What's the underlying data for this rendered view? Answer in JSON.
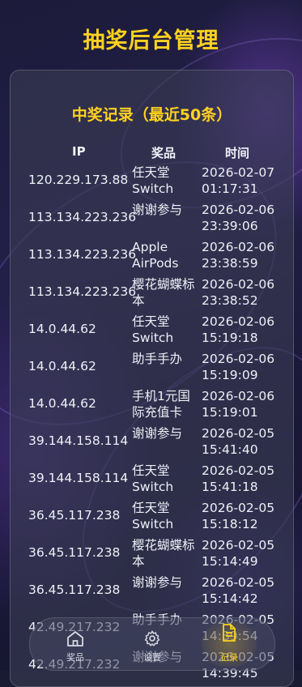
{
  "page": {
    "title": "抽奖后台管理"
  },
  "records": {
    "title": "中奖记录（最近50条）",
    "headers": {
      "ip": "IP",
      "prize": "奖品",
      "time": "时间"
    },
    "rows": [
      {
        "ip": "120.229.173.88",
        "prize": "任天堂 Switch",
        "time": "2026-02-07 01:17:31"
      },
      {
        "ip": "113.134.223.236",
        "prize": "谢谢参与",
        "time": "2026-02-06 23:39:06"
      },
      {
        "ip": "113.134.223.236",
        "prize": "Apple AirPods",
        "time": "2026-02-06 23:38:59"
      },
      {
        "ip": "113.134.223.236",
        "prize": "樱花蝴蝶标本",
        "time": "2026-02-06 23:38:52"
      },
      {
        "ip": "14.0.44.62",
        "prize": "任天堂 Switch",
        "time": "2026-02-06 15:19:18"
      },
      {
        "ip": "14.0.44.62",
        "prize": "助手手办",
        "time": "2026-02-06 15:19:09"
      },
      {
        "ip": "14.0.44.62",
        "prize": "手机1元国际充值卡",
        "time": "2026-02-06 15:19:01"
      },
      {
        "ip": "39.144.158.114",
        "prize": "谢谢参与",
        "time": "2026-02-05 15:41:40"
      },
      {
        "ip": "39.144.158.114",
        "prize": "任天堂 Switch",
        "time": "2026-02-05 15:41:18"
      },
      {
        "ip": "36.45.117.238",
        "prize": "任天堂 Switch",
        "time": "2026-02-05 15:18:12"
      },
      {
        "ip": "36.45.117.238",
        "prize": "樱花蝴蝶标本",
        "time": "2026-02-05 15:14:49"
      },
      {
        "ip": "36.45.117.238",
        "prize": "谢谢参与",
        "time": "2026-02-05 15:14:42"
      },
      {
        "ip": "42.49.217.232",
        "prize": "助手手办",
        "time": "2026-02-05 14:39:54"
      },
      {
        "ip": "42.49.217.232",
        "prize": "谢谢参与",
        "time": "2026-02-05 14:39:45"
      }
    ]
  },
  "nav": {
    "items": [
      {
        "key": "prizes",
        "label": "奖品",
        "icon": "home-icon",
        "active": false
      },
      {
        "key": "settings",
        "label": "设置",
        "icon": "gear-icon",
        "active": false
      },
      {
        "key": "records",
        "label": "记录",
        "icon": "document-icon",
        "active": true
      }
    ]
  },
  "colors": {
    "accent": "#ffd21f",
    "background": "#1d1c3c",
    "card": "#3a3c54",
    "text": "#eef0f6"
  }
}
